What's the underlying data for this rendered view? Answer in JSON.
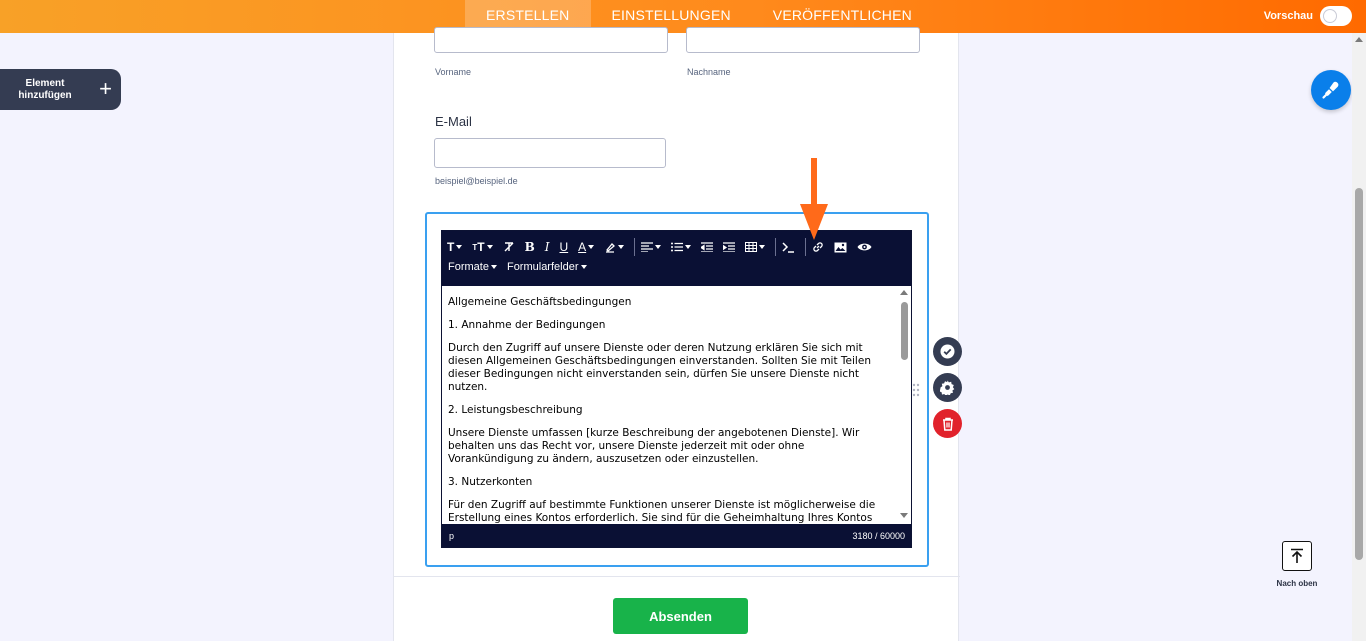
{
  "header": {
    "tabs": [
      {
        "label": "ERSTELLEN",
        "active": true
      },
      {
        "label": "EINSTELLUNGEN",
        "active": false
      },
      {
        "label": "VERÖFFENTLICHEN",
        "active": false
      }
    ],
    "preview_label": "Vorschau",
    "preview_on": false,
    "accent_color": "#ff8a1c"
  },
  "sidebar": {
    "add_element_label": "Element hinzufügen"
  },
  "form": {
    "first_name_sublabel": "Vorname",
    "last_name_sublabel": "Nachname",
    "email_label": "E-Mail",
    "email_sublabel": "beispiel@beispiel.de",
    "submit_label": "Absenden"
  },
  "editor": {
    "toolbar_row2": [
      "Formate",
      "Formularfelder"
    ],
    "content": [
      "Allgemeine Geschäftsbedingungen",
      "1. Annahme der Bedingungen",
      "Durch den Zugriff auf unsere Dienste oder deren Nutzung erklären Sie sich mit diesen Allgemeinen Geschäftsbedingungen einverstanden. Sollten Sie mit Teilen dieser Bedingungen nicht einverstanden sein, dürfen Sie unsere Dienste nicht nutzen.",
      "2. Leistungsbeschreibung",
      "Unsere Dienste umfassen [kurze Beschreibung der angebotenen Dienste]. Wir behalten uns das Recht vor, unsere Dienste jederzeit mit oder ohne Vorankündigung zu ändern, auszusetzen oder einzustellen.",
      "3. Nutzerkonten",
      "Für den Zugriff auf bestimmte Funktionen unserer Dienste ist möglicherweise die Erstellung eines Kontos erforderlich. Sie sind für die Geheimhaltung Ihres Kontos verantwortlich."
    ],
    "status_path": "p",
    "char_count": "3180 / 60000"
  },
  "utility": {
    "back_to_top_label": "Nach oben"
  },
  "icons": {
    "palette": "paint-roller-icon",
    "side_actions": [
      "check-circle-icon",
      "gear-icon",
      "trash-icon"
    ]
  }
}
